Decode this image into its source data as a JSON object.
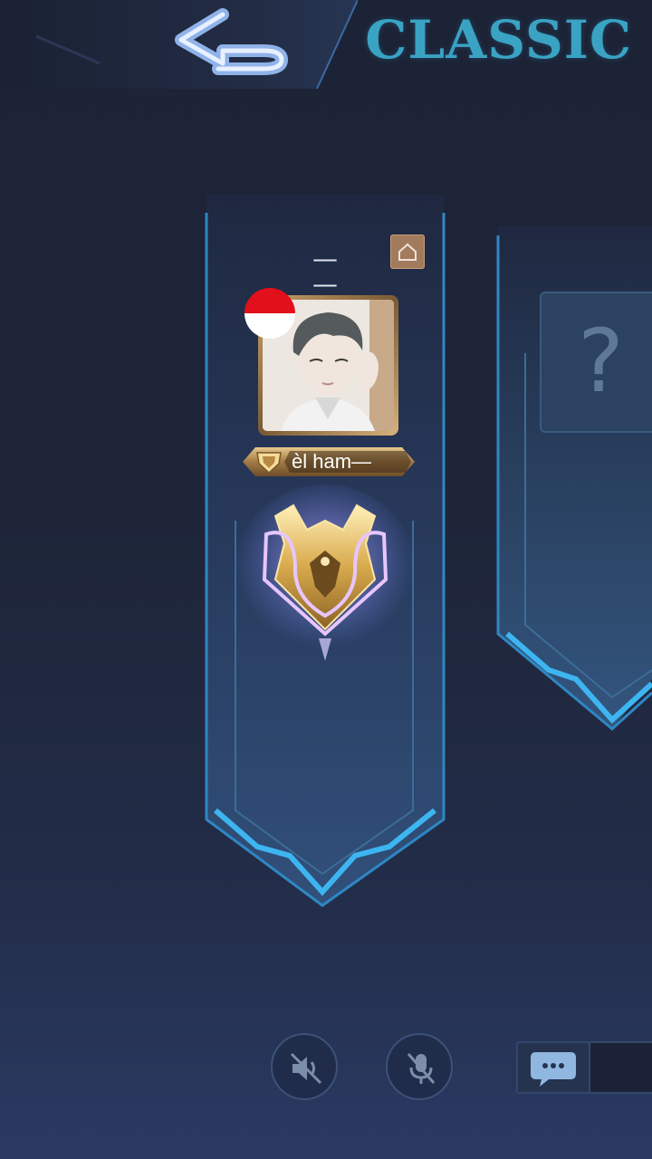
{
  "header": {
    "mode_title": "CLASSIC"
  },
  "player_card": {
    "name": "— —",
    "tag": "èl ham—",
    "flag_colors": [
      "#e2101a",
      "#ffffff"
    ]
  },
  "empty_slot": {
    "placeholder": "?"
  },
  "icons": {
    "back": "back-arrow-icon",
    "home": "home-icon",
    "speaker_off": "speaker-off-icon",
    "mic_off": "mic-off-icon",
    "chat": "chat-bubble-icon"
  },
  "colors": {
    "accent_blue": "#3aa3c4",
    "card_border": "#2e87c4",
    "gold": "#d7b27a"
  }
}
